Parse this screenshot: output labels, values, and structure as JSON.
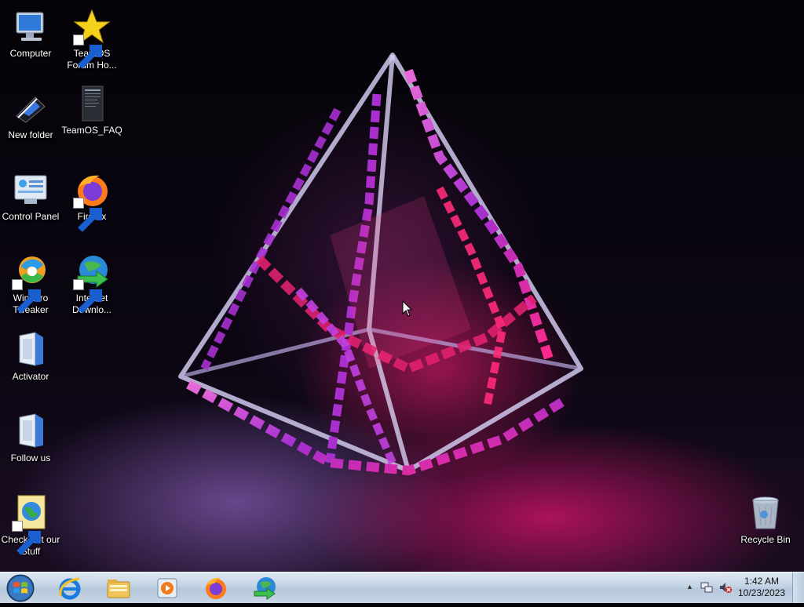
{
  "desktop": {
    "icons": [
      {
        "label": "Computer"
      },
      {
        "label": "TeamOS Forum Ho..."
      },
      {
        "label": "New folder"
      },
      {
        "label": "TeamOS_FAQ"
      },
      {
        "label": "Control Panel"
      },
      {
        "label": "Firefox"
      },
      {
        "label": "Winaero Tweaker"
      },
      {
        "label": "Internet Downlo..."
      },
      {
        "label": "Activator"
      },
      {
        "label": "Follow us"
      },
      {
        "label": "Check out our Stuff"
      },
      {
        "label": "Recycle Bin"
      }
    ]
  },
  "taskbar": {
    "start_icon": "windows-orb-icon",
    "pinned": [
      {
        "icon": "internet-explorer-icon"
      },
      {
        "icon": "file-explorer-icon"
      },
      {
        "icon": "media-player-icon"
      },
      {
        "icon": "firefox-icon"
      },
      {
        "icon": "internet-download-manager-icon"
      }
    ],
    "tray": {
      "network_icon": "network-icon",
      "volume_icon": "volume-muted-icon",
      "time": "1:42 AM",
      "date": "10/23/2023"
    }
  },
  "colors": {
    "taskbar": "#c3d3e4",
    "wallpaper_accent": "#e0206e",
    "wallpaper_secondary": "#a060e0"
  }
}
